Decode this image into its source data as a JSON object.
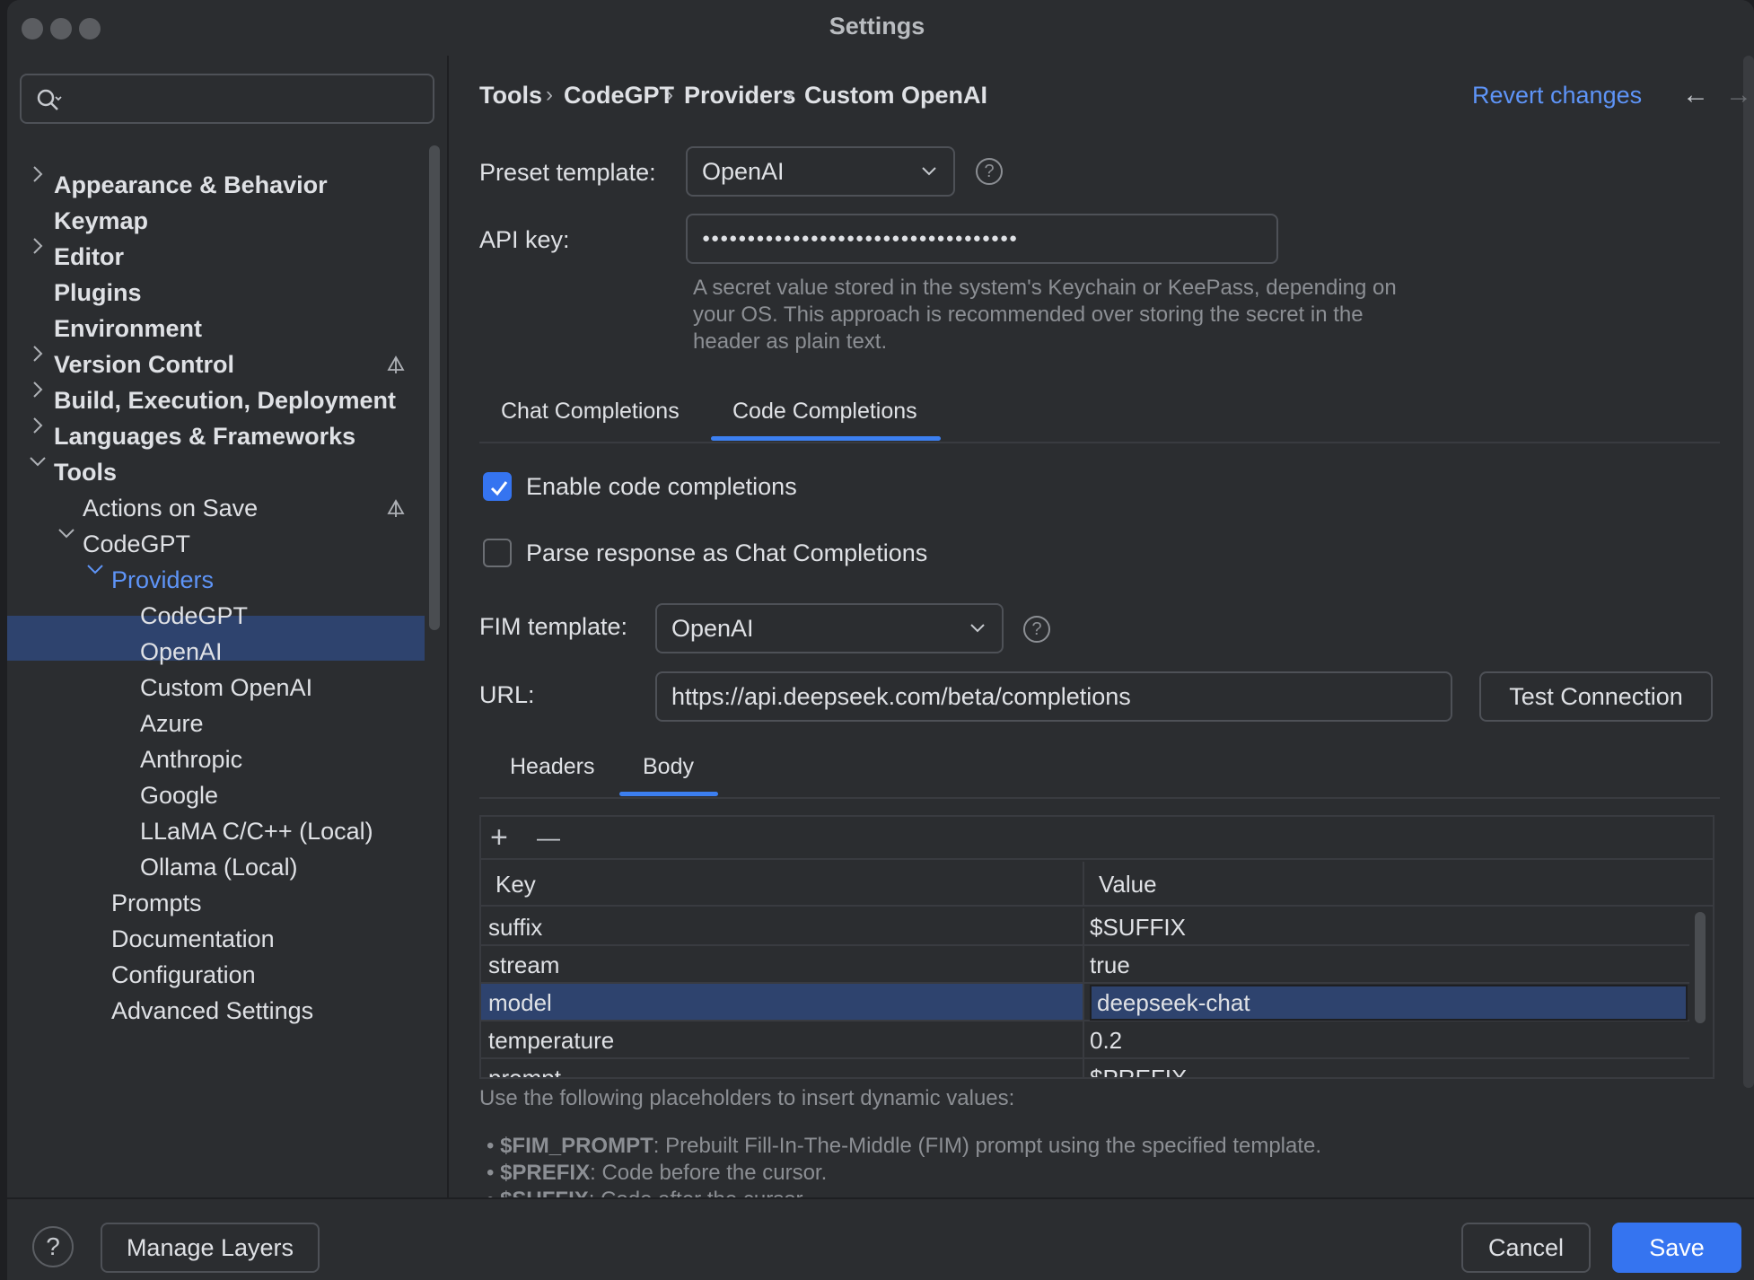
{
  "window": {
    "title": "Settings"
  },
  "sidebar": {
    "search_placeholder": "",
    "items": [
      {
        "label": "Appearance & Behavior"
      },
      {
        "label": "Keymap"
      },
      {
        "label": "Editor"
      },
      {
        "label": "Plugins"
      },
      {
        "label": "Environment"
      },
      {
        "label": "Version Control"
      },
      {
        "label": "Build, Execution, Deployment"
      },
      {
        "label": "Languages & Frameworks"
      },
      {
        "label": "Tools"
      },
      {
        "label": "Actions on Save"
      },
      {
        "label": "CodeGPT"
      },
      {
        "label": "Providers"
      },
      {
        "label": "CodeGPT"
      },
      {
        "label": "OpenAI"
      },
      {
        "label": "Custom OpenAI"
      },
      {
        "label": "Azure"
      },
      {
        "label": "Anthropic"
      },
      {
        "label": "Google"
      },
      {
        "label": "LLaMA C/C++ (Local)"
      },
      {
        "label": "Ollama (Local)"
      },
      {
        "label": "Prompts"
      },
      {
        "label": "Documentation"
      },
      {
        "label": "Configuration"
      },
      {
        "label": "Advanced Settings"
      }
    ]
  },
  "header": {
    "breadcrumb": [
      "Tools",
      "CodeGPT",
      "Providers",
      "Custom OpenAI"
    ],
    "separator": "›",
    "revert_label": "Revert changes"
  },
  "form": {
    "preset_label": "Preset template:",
    "preset_value": "OpenAI",
    "api_key_label": "API key:",
    "api_key_value": "●●●●●●●●●●●●●●●●●●●●●●●●●●●●●●●●●●●",
    "api_key_hint": "A secret value stored in the system's Keychain or KeePass, depending on your OS. This approach is recommended over storing the secret in the header as plain text.",
    "tabs": [
      "Chat Completions",
      "Code Completions"
    ],
    "enable_label": "Enable code completions",
    "parse_label": "Parse response as Chat Completions",
    "fim_label": "FIM template:",
    "fim_value": "OpenAI",
    "url_label": "URL:",
    "url_value": "https://api.deepseek.com/beta/completions",
    "test_button": "Test Connection",
    "subtabs": [
      "Headers",
      "Body"
    ]
  },
  "table": {
    "add_symbol": "+",
    "remove_symbol": "—",
    "col_key": "Key",
    "col_value": "Value",
    "rows": [
      {
        "key": "suffix",
        "value": "$SUFFIX"
      },
      {
        "key": "stream",
        "value": "true"
      },
      {
        "key": "model",
        "value": "deepseek-chat"
      },
      {
        "key": "temperature",
        "value": "0.2"
      },
      {
        "key": "prompt",
        "value": "$PREFIX"
      }
    ]
  },
  "placeholders": {
    "intro": "Use the following placeholders to insert dynamic values:",
    "items": [
      {
        "name": "$FIM_PROMPT",
        "desc": ": Prebuilt Fill-In-The-Middle (FIM) prompt using the specified template."
      },
      {
        "name": "$PREFIX",
        "desc": ": Code before the cursor."
      },
      {
        "name": "$SUFFIX",
        "desc": ": Code after the cursor."
      }
    ]
  },
  "footer": {
    "help": "?",
    "manage_layers": "Manage Layers",
    "cancel": "Cancel",
    "save": "Save"
  },
  "colors": {
    "accent": "#3574f0",
    "link": "#5e94f7",
    "selection": "#2e436e"
  }
}
